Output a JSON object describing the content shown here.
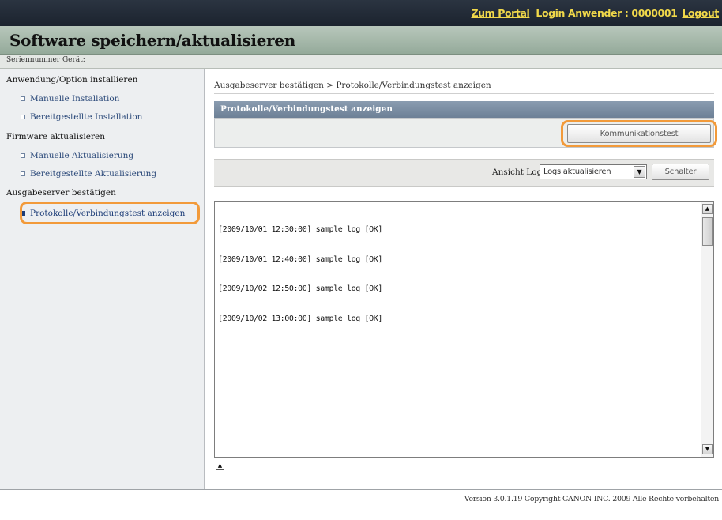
{
  "header": {
    "portal_link": "Zum Portal",
    "login_text": "Login Anwender : 0000001",
    "logout_link": "Logout"
  },
  "title": "Software speichern/aktualisieren",
  "serial_label": "Seriennummer Gerät:",
  "sidebar": {
    "sections": [
      {
        "title": "Anwendung/Option installieren",
        "items": [
          "Manuelle Installation",
          "Bereitgestellte Installation"
        ]
      },
      {
        "title": "Firmware aktualisieren",
        "items": [
          "Manuelle Aktualisierung",
          "Bereitgestellte Aktualisierung"
        ]
      },
      {
        "title": "Ausgabeserver bestätigen",
        "items": [
          "Protokolle/Verbindungstest anzeigen"
        ]
      }
    ],
    "active_item": "Protokolle/Verbindungstest anzeigen"
  },
  "breadcrumb": "Ausgabeserver bestätigen > Protokolle/Verbindungstest anzeigen",
  "section_title": "Protokolle/Verbindungstest anzeigen",
  "buttons": {
    "communication_test": "Kommunikationstest",
    "switch": "Schalter"
  },
  "view_log": {
    "label": "Ansicht Log:",
    "selected": "Logs aktualisieren"
  },
  "log_lines": [
    "[2009/10/01 12:30:00] sample log [OK]",
    "[2009/10/01 12:40:00] sample log [OK]",
    "[2009/10/02 12:50:00] sample log [OK]",
    "[2009/10/02 13:00:00] sample log [OK]"
  ],
  "footer": "Version 3.0.1.19 Copyright CANON INC. 2009 Alle Rechte vorbehalten",
  "colors": {
    "topbar": "#1b232e",
    "header_link": "#f0d84a",
    "highlight": "#f29a3a",
    "section_header": "#7a8da3"
  },
  "icons": {
    "select_arrow": "chevron-down-icon",
    "scroll_up": "arrow-up-icon",
    "scroll_down": "arrow-down-icon",
    "back_to_top": "back-to-top-icon"
  }
}
